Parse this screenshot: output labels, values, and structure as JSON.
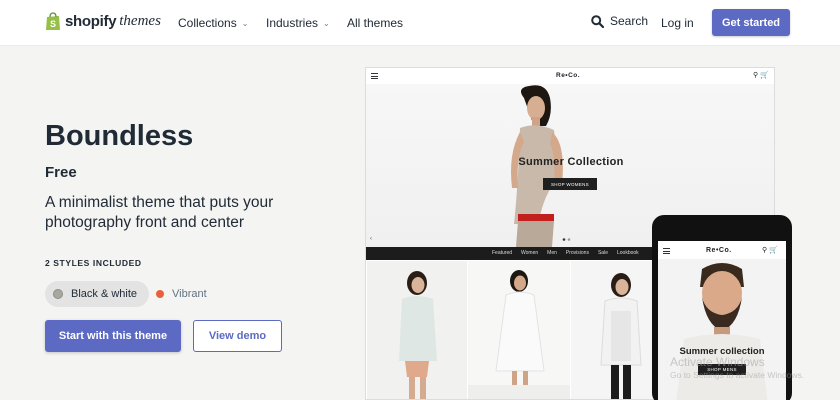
{
  "header": {
    "logo_brand": "shopify",
    "logo_suffix": "themes",
    "nav": [
      {
        "label": "Collections",
        "has_dropdown": true
      },
      {
        "label": "Industries",
        "has_dropdown": true
      },
      {
        "label": "All themes",
        "has_dropdown": false
      }
    ],
    "search_label": "Search",
    "login_label": "Log in",
    "cta_label": "Get started"
  },
  "theme": {
    "name": "Boundless",
    "price": "Free",
    "tagline": "A minimalist theme that puts your photography front and center",
    "styles_heading": "2 STYLES INCLUDED",
    "styles": [
      {
        "label": "Black & white",
        "color": "#a8a8a0",
        "selected": true
      },
      {
        "label": "Vibrant",
        "color": "#e8603c",
        "selected": false
      }
    ],
    "primary_cta": "Start with this theme",
    "secondary_cta": "View demo"
  },
  "desktop_preview": {
    "brand": "Re•Co.",
    "hero_title": "Summer Collection",
    "hero_button": "SHOP WOMENS",
    "nav_items": [
      "Featured",
      "Women",
      "Men",
      "Provisions",
      "Sale",
      "Lookbook"
    ]
  },
  "mobile_preview": {
    "brand": "Re•Co.",
    "hero_title": "Summer collection",
    "hero_button": "SHOP MENS"
  },
  "watermark": {
    "line1": "Activate Windows",
    "line2": "Go to Settings to activate Windows."
  },
  "colors": {
    "accent": "#5c6ac4",
    "background": "#f4f4f3",
    "logo_green": "#95bf47"
  }
}
